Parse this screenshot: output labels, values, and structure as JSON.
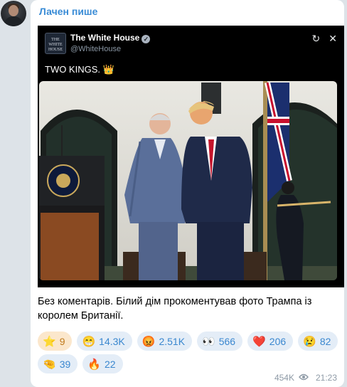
{
  "message": {
    "sender": "Лачен пише",
    "caption": "Без коментарів. Білий дім прокоментував фото Трампа із королем Британії.",
    "views": "454K",
    "time": "21:23"
  },
  "tweet": {
    "logo_text": "THE WHITE HOUSE",
    "name": "The White House",
    "handle": "@WhiteHouse",
    "text": "TWO KINGS. 👑",
    "icons": [
      "refresh-icon",
      "x-logo-icon"
    ]
  },
  "reactions": [
    {
      "emoji": "⭐",
      "count": "9",
      "own": true
    },
    {
      "emoji": "😁",
      "count": "14.3K"
    },
    {
      "emoji": "😡",
      "count": "2.51K"
    },
    {
      "emoji": "👀",
      "count": "566"
    },
    {
      "emoji": "❤️",
      "count": "206"
    },
    {
      "emoji": "😢",
      "count": "82"
    },
    {
      "emoji": "🤏",
      "count": "39"
    },
    {
      "emoji": "🔥",
      "count": "22"
    }
  ],
  "colors": {
    "accent": "#3a8cd6",
    "reaction_bg": "#e4edf7",
    "own_reaction_bg": "#fbe7cc",
    "page_bg": "#dde3e8"
  }
}
